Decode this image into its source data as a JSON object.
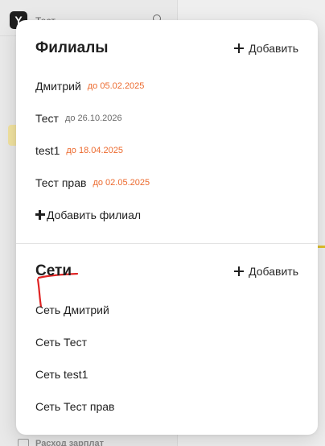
{
  "app": {
    "org_name": "Тест",
    "logo_letter": "Y",
    "bottom_item": "Расход зарплат"
  },
  "branches": {
    "title": "Филиалы",
    "add_label": "Добавить",
    "items": [
      {
        "name": "Дмитрий",
        "date": "до 05.02.2025",
        "expired": true
      },
      {
        "name": "Тест",
        "date": "до 26.10.2026",
        "expired": false
      },
      {
        "name": "test1",
        "date": "до 18.04.2025",
        "expired": true
      },
      {
        "name": "Тест прав",
        "date": "до 02.05.2025",
        "expired": true
      }
    ],
    "add_branch_label": "Добавить филиал"
  },
  "networks": {
    "title": "Сети",
    "add_label": "Добавить",
    "items": [
      {
        "name": "Сеть Дмитрий"
      },
      {
        "name": "Сеть Тест"
      },
      {
        "name": "Сеть test1"
      },
      {
        "name": "Сеть Тест прав"
      }
    ]
  },
  "colors": {
    "expired_date": "#ec6a2e",
    "active_date": "#6b6b6b",
    "annotation": "#e02424",
    "accent_yellow": "#e0c02c"
  }
}
